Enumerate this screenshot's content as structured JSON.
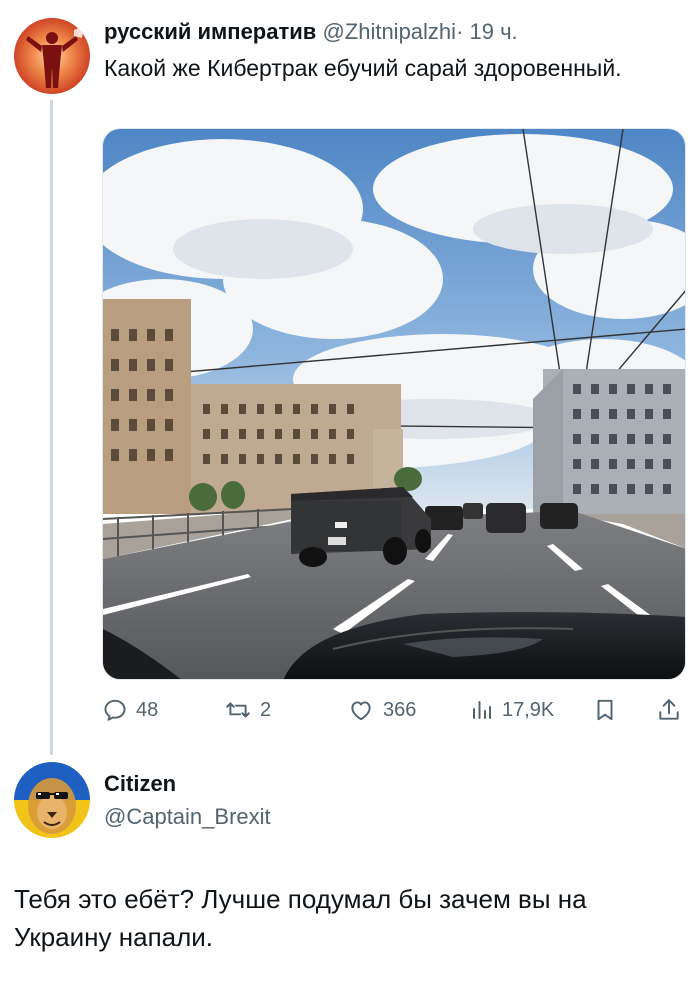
{
  "tweet1": {
    "display_name": "русский императив",
    "handle": "@Zhitnipalzhi",
    "separator": "·",
    "time": "19 ч.",
    "text": "Какой же Кибертрак ебучий сарай здоровенный.",
    "stats": {
      "replies": "48",
      "retweets": "2",
      "likes": "366",
      "views": "17,9K"
    },
    "icons": [
      "reply-icon",
      "retweet-icon",
      "like-icon",
      "views-icon",
      "bookmark-icon",
      "share-icon"
    ]
  },
  "tweet2": {
    "display_name": "Citizen",
    "handle": "@Captain_Brexit",
    "text": "Тебя это ебёт? Лучше подумал бы зачем вы на Украину напали."
  },
  "colors": {
    "text_primary": "#0f1419",
    "text_secondary": "#536471",
    "thread_line": "#cfd9de"
  }
}
